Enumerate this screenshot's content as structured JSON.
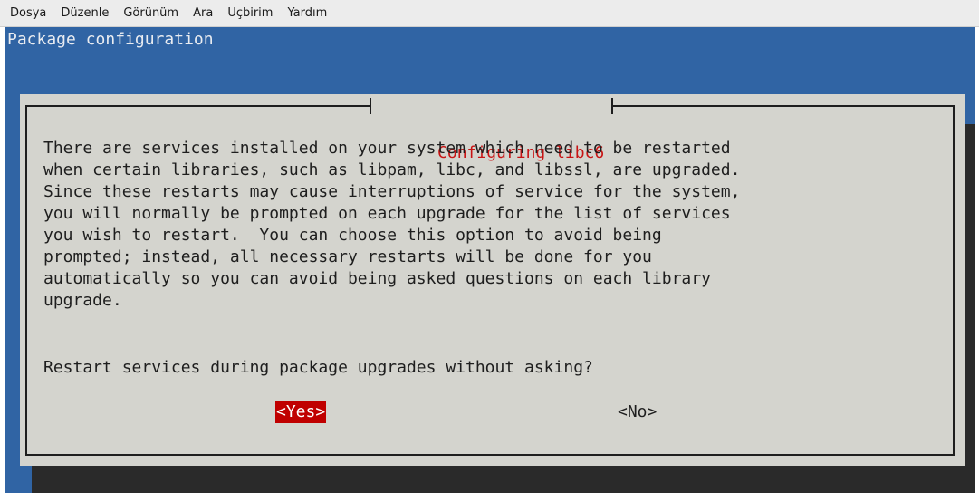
{
  "menubar": {
    "items": [
      "Dosya",
      "Düzenle",
      "Görünüm",
      "Ara",
      "Uçbirim",
      "Yardım"
    ]
  },
  "terminal": {
    "backtitle": "Package configuration",
    "dialog": {
      "title": "Configuring libc6",
      "body": "There are services installed on your system which need to be restarted\nwhen certain libraries, such as libpam, libc, and libssl, are upgraded.\nSince these restarts may cause interruptions of service for the system,\nyou will normally be prompted on each upgrade for the list of services\nyou wish to restart.  You can choose this option to avoid being\nprompted; instead, all necessary restarts will be done for you\nautomatically so you can avoid being asked questions on each library\nupgrade.",
      "question": "Restart services during package upgrades without asking?",
      "yes_label": "<Yes>",
      "no_label": "<No>"
    }
  },
  "colors": {
    "background": "#3064a4",
    "dialog": "#d4d4ce",
    "title": "#c81414",
    "selected_button": "#c00000"
  }
}
